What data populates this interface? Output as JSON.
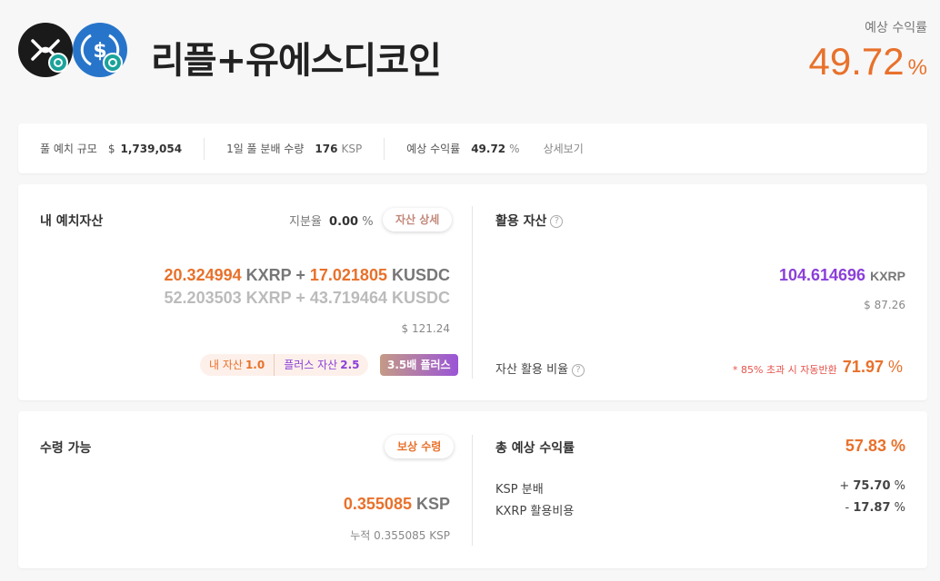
{
  "header": {
    "title": "리플+유에스디코인",
    "apr_label": "예상 수익률",
    "apr_value": "49.72",
    "apr_unit": "%",
    "coins": [
      "xrp-coin-icon",
      "usdc-coin-icon"
    ]
  },
  "summary": {
    "pool_label": "풀 예치 규모",
    "pool_currency": "$",
    "pool_value": "1,739,054",
    "daily_label": "1일 풀 분배 수량",
    "daily_value": "176",
    "daily_unit": "KSP",
    "apr_label": "예상 수익률",
    "apr_value": "49.72",
    "apr_unit": "%",
    "detail_link": "상세보기"
  },
  "my_deposit": {
    "title": "내 예치자산",
    "share_label": "지분율",
    "share_value": "0.00",
    "share_unit": "%",
    "detail_button": "자산 상세",
    "line1_a": "20.324994",
    "line1_a_sym": "KXRP",
    "line1_plus": "+",
    "line1_b": "17.021805",
    "line1_b_sym": "KUSDC",
    "line2_a": "52.203503",
    "line2_a_sym": "KXRP",
    "line2_plus": "+",
    "line2_b": "43.719464",
    "line2_b_sym": "KUSDC",
    "usd_currency": "$",
    "usd_value": "121.24",
    "my_asset_label": "내 자산",
    "my_asset_value": "1.0",
    "plus_asset_label": "플러스 자산",
    "plus_asset_value": "2.5",
    "multiplier_badge": "3.5배 플러스"
  },
  "utilized": {
    "title": "활용 자산",
    "amount": "104.614696",
    "amount_sym": "KXRP",
    "usd_currency": "$",
    "usd_value": "87.26",
    "ratio_label": "자산 활용 비율",
    "auto_return_note": "* 85% 초과 시 자동반환",
    "ratio_value": "71.97",
    "ratio_unit": "%"
  },
  "claimable": {
    "title": "수령 가능",
    "claim_button": "보상 수령",
    "amount": "0.355085",
    "amount_sym": "KSP",
    "cumulative_label": "누적",
    "cumulative_value": "0.355085",
    "cumulative_sym": "KSP"
  },
  "total_return": {
    "title": "총 예상 수익률",
    "value": "57.83",
    "unit": "%",
    "rows": [
      {
        "label": "KSP 분배",
        "sign": "+",
        "value": "75.70",
        "unit": "%"
      },
      {
        "label": "KXRP 활용비용",
        "sign": "-",
        "value": "17.87",
        "unit": "%"
      }
    ]
  },
  "colors": {
    "accent_orange": "#e8712b",
    "accent_purple": "#8b3fd9",
    "note_red": "#e5524a",
    "xrp_bg": "#1a1a1a",
    "usdc_bg": "#2775ca"
  }
}
